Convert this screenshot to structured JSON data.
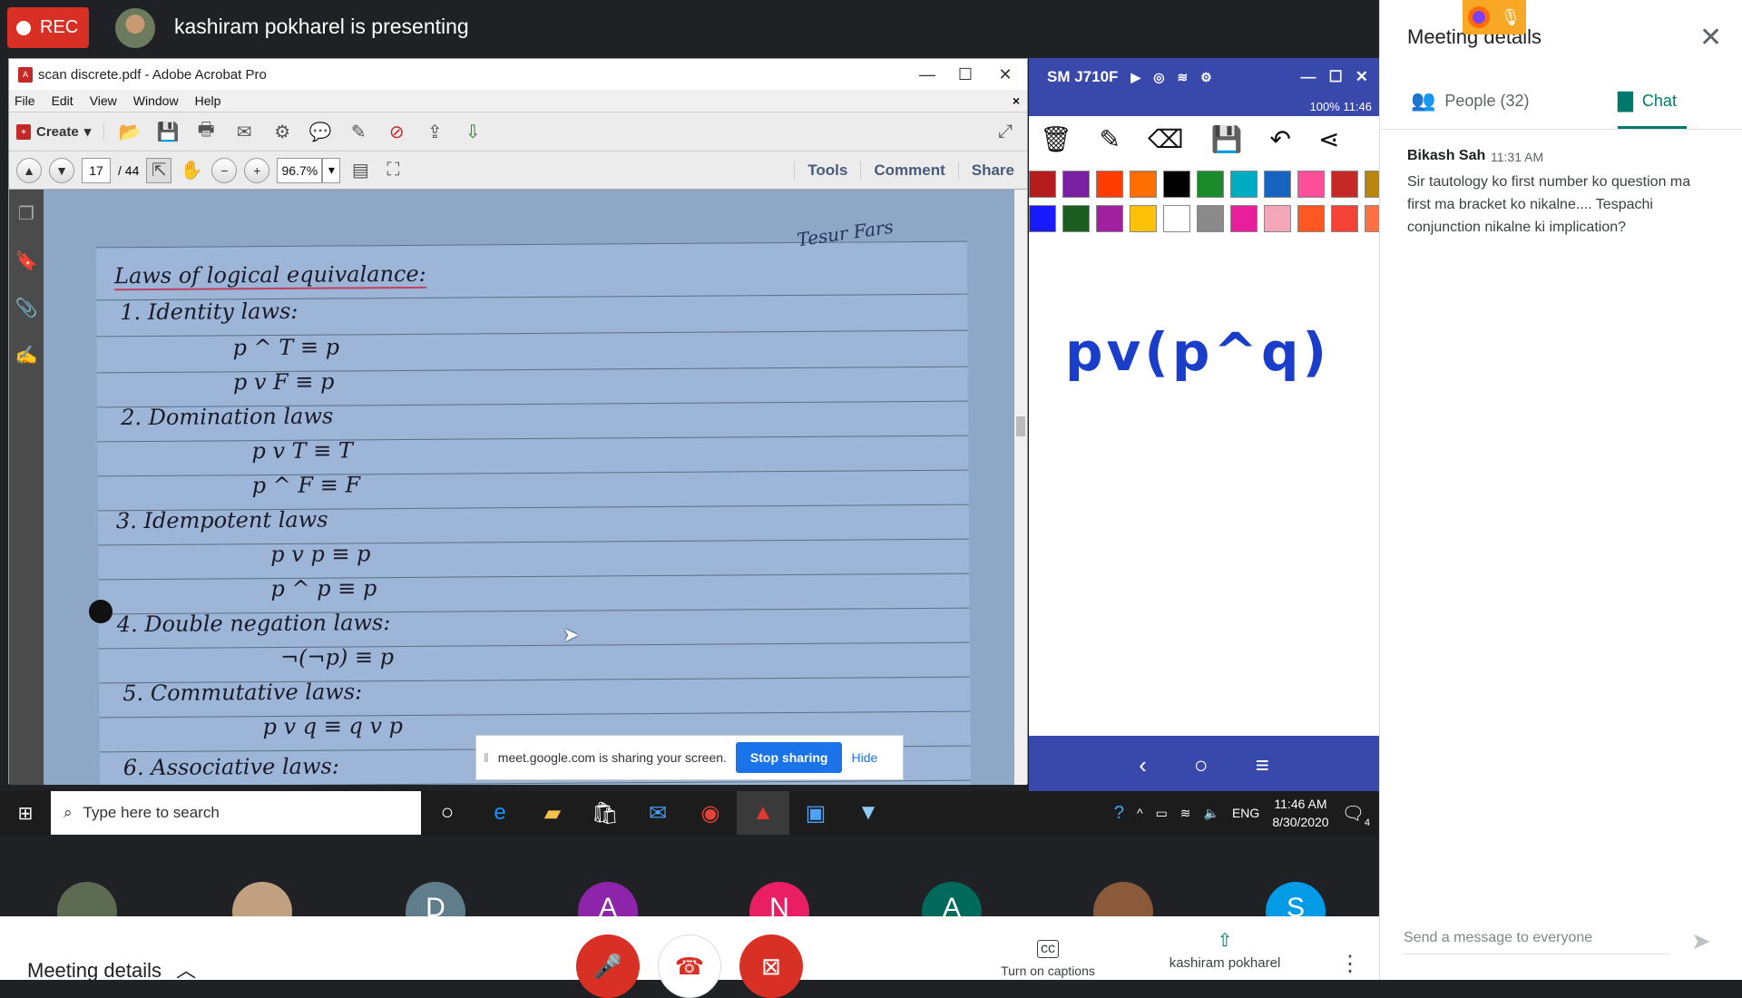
{
  "meeting": {
    "rec_label": "REC",
    "presenting_text": "kashiram pokharel is presenting"
  },
  "acrobat": {
    "title": "scan discrete.pdf - Adobe Acrobat Pro",
    "menu": [
      "File",
      "Edit",
      "View",
      "Window",
      "Help"
    ],
    "create_label": "Create",
    "page_current": "17",
    "page_total": "/ 44",
    "zoom": "96.7%",
    "tabs": [
      "Tools",
      "Comment",
      "Share"
    ]
  },
  "pdf_page": {
    "signature": "Tesur Fars",
    "heading": "Laws of logical equivalance:",
    "lines": [
      "1. Identity laws:",
      "p ^ T ≡ p",
      "p v F ≡ p",
      "2. Domination laws",
      "p v T ≡ T",
      "p ^ F ≡ F",
      "3. Idempotent laws",
      "p v p ≡ p",
      "p ^ p ≡ p",
      "4. Double negation laws:",
      "¬(¬p) ≡ p",
      "5. Commutative laws:",
      "p v q ≡ q v p",
      "6. Associative laws:"
    ]
  },
  "android": {
    "device_name": "SM J710F",
    "status": "100% 11:46",
    "formula": "pv(p^q)",
    "swatches_row1": [
      "#b71c1c",
      "#7b1fa2",
      "#ff3d00",
      "#ff6f00",
      "#000000",
      "#1b8a2a",
      "#00acc1",
      "#1565c0",
      "#ff4f9a",
      "#c62828",
      "#b8860b"
    ],
    "swatches_row2": [
      "#1a1aff",
      "#1b5e20",
      "#a020a0",
      "#ffc107",
      "#ffffff",
      "#8a8a8a",
      "#e91e9c",
      "#f4a7b9",
      "#ff5722",
      "#f44336",
      "#ff7043"
    ]
  },
  "share_bar": {
    "text": "meet.google.com is sharing your screen.",
    "stop_label": "Stop sharing",
    "hide_label": "Hide"
  },
  "taskbar": {
    "search_placeholder": "Type here to search",
    "lang": "ENG",
    "time": "11:46 AM",
    "date": "8/30/2020",
    "notif_count": "4"
  },
  "participants": [
    {
      "initial": "",
      "color": "#5d6b52"
    },
    {
      "initial": "",
      "color": "#c0a080"
    },
    {
      "initial": "D",
      "color": "#607d8b"
    },
    {
      "initial": "A",
      "color": "#8e24aa"
    },
    {
      "initial": "N",
      "color": "#e91e63"
    },
    {
      "initial": "A",
      "color": "#00695c"
    },
    {
      "initial": "",
      "color": "#8a5a3a"
    },
    {
      "initial": "S",
      "color": "#039be5"
    }
  ],
  "bottom_bar": {
    "meeting_details": "Meeting details",
    "captions_label": "Turn on captions",
    "presenter_label": "kashiram pokharel"
  },
  "panel": {
    "title": "Meeting details",
    "people_tab": "People (32)",
    "chat_tab": "Chat",
    "message": {
      "author": "Bikash Sah",
      "time": "11:31 AM",
      "text": "Sir tautology ko first number ko question ma first ma bracket ko nikalne.... Tespachi conjunction nikalne ki implication?"
    },
    "input_placeholder": "Send a message to everyone"
  }
}
